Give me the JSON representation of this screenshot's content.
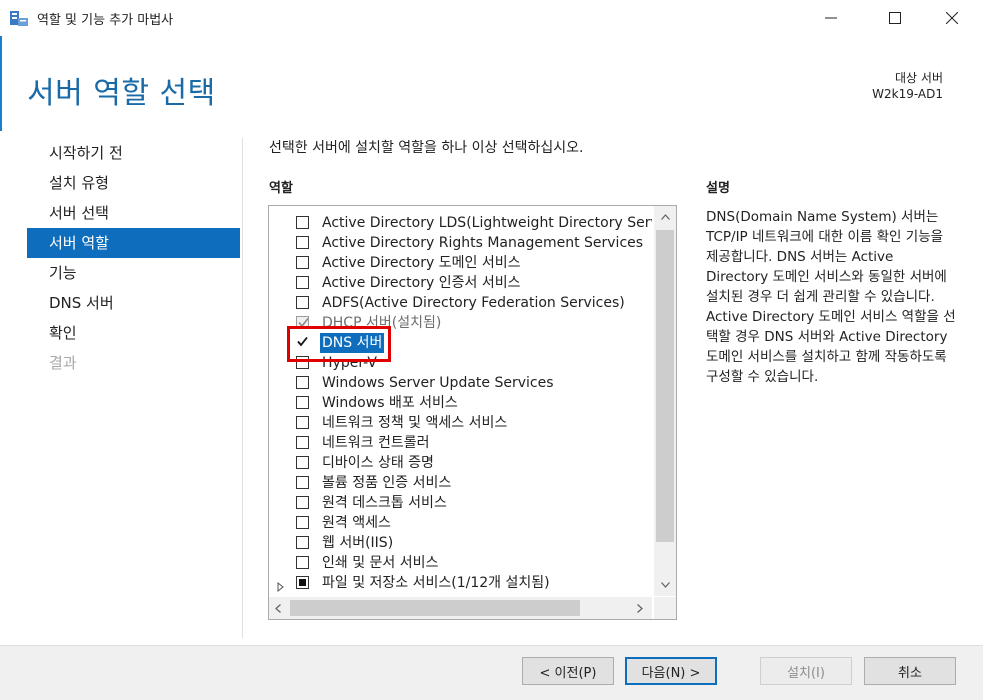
{
  "window": {
    "title": "역할 및 기능 추가 마법사"
  },
  "header": {
    "page_title": "서버 역할 선택",
    "target_label": "대상 서버",
    "target_value": "W2k19-AD1"
  },
  "nav": {
    "items": [
      {
        "label": "시작하기 전",
        "state": "normal"
      },
      {
        "label": "설치 유형",
        "state": "normal"
      },
      {
        "label": "서버 선택",
        "state": "normal"
      },
      {
        "label": "서버 역할",
        "state": "active"
      },
      {
        "label": "기능",
        "state": "normal"
      },
      {
        "label": "DNS 서버",
        "state": "normal"
      },
      {
        "label": "확인",
        "state": "normal"
      },
      {
        "label": "결과",
        "state": "disabled"
      }
    ]
  },
  "main": {
    "instruction": "선택한 서버에 설치할 역할을 하나 이상 선택하십시오.",
    "roles_header": "역할",
    "description_header": "설명",
    "roles": [
      {
        "label": "Active Directory LDS(Lightweight Directory Services)",
        "state": "unchecked"
      },
      {
        "label": "Active Directory Rights Management Services",
        "state": "unchecked"
      },
      {
        "label": "Active Directory 도메인 서비스",
        "state": "unchecked"
      },
      {
        "label": "Active Directory 인증서 서비스",
        "state": "unchecked"
      },
      {
        "label": "ADFS(Active Directory Federation Services)",
        "state": "unchecked"
      },
      {
        "label": "DHCP 서버(설치됨)",
        "state": "installed"
      },
      {
        "label": "DNS 서버",
        "state": "checked"
      },
      {
        "label": "Hyper-V",
        "state": "unchecked"
      },
      {
        "label": "Windows Server Update Services",
        "state": "unchecked"
      },
      {
        "label": "Windows 배포 서비스",
        "state": "unchecked"
      },
      {
        "label": "네트워크 정책 및 액세스 서비스",
        "state": "unchecked"
      },
      {
        "label": "네트워크 컨트롤러",
        "state": "unchecked"
      },
      {
        "label": "디바이스 상태 증명",
        "state": "unchecked"
      },
      {
        "label": "볼륨 정품 인증 서비스",
        "state": "unchecked"
      },
      {
        "label": "원격 데스크톱 서비스",
        "state": "unchecked"
      },
      {
        "label": "원격 액세스",
        "state": "unchecked"
      },
      {
        "label": "웹 서버(IIS)",
        "state": "unchecked"
      },
      {
        "label": "인쇄 및 문서 서비스",
        "state": "unchecked"
      },
      {
        "label": "파일 및 저장소 서비스(1/12개 설치됨)",
        "state": "partial",
        "expandable": true
      }
    ],
    "description": "DNS(Domain Name System) 서버는 TCP/IP 네트워크에 대한 이름 확인 기능을 제공합니다. DNS 서버는 Active Directory 도메인 서비스와 동일한 서버에 설치된 경우 더 쉽게 관리할 수 있습니다. Active Directory 도메인 서비스 역할을 선택할 경우 DNS 서버와 Active Directory 도메인 서비스를 설치하고 함께 작동하도록 구성할 수 있습니다."
  },
  "footer": {
    "prev_label": "< 이전(P)",
    "next_label": "다음(N) >",
    "install_label": "설치(I)",
    "cancel_label": "취소"
  },
  "colors": {
    "accent": "#0e6ebd",
    "title_blue": "#1a6aa8",
    "highlight_red": "#e00000"
  }
}
